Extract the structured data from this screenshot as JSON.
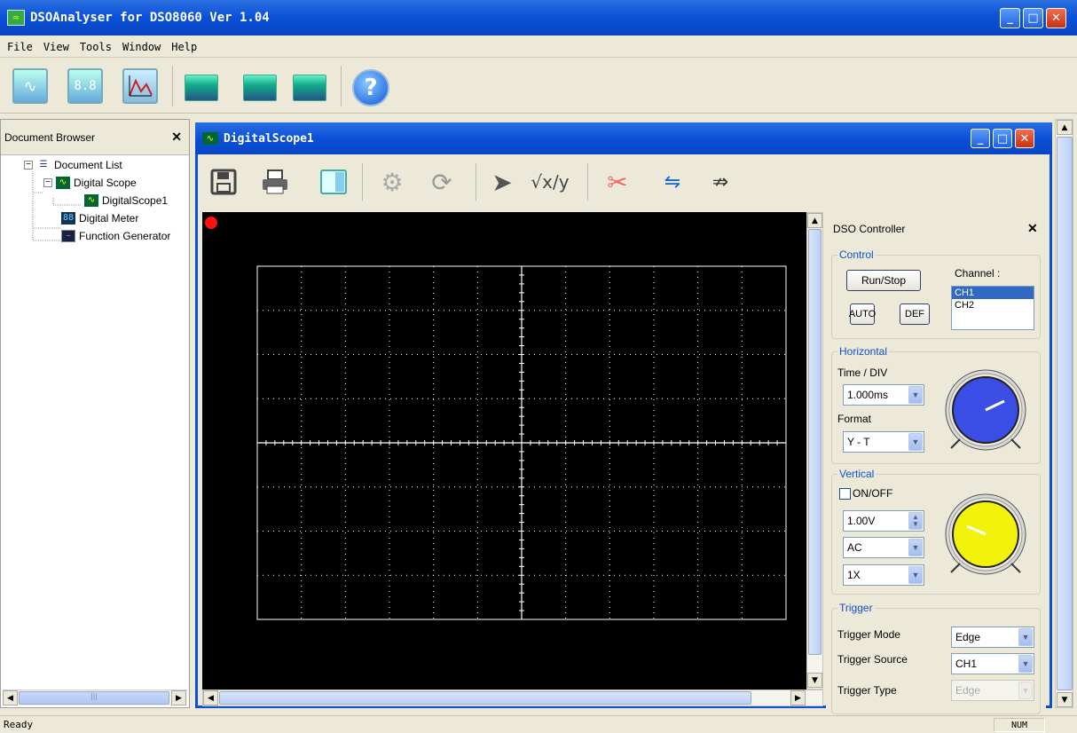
{
  "app": {
    "title": "DSOAnalyser for DSO8060 Ver 1.04"
  },
  "menu": [
    "File",
    "View",
    "Tools",
    "Window",
    "Help"
  ],
  "doc_browser": {
    "title": "Document Browser",
    "tree": {
      "root": "Document List",
      "scope": "Digital Scope",
      "scope_child": "DigitalScope1",
      "meter": "Digital Meter",
      "generator": "Function Generator"
    }
  },
  "child_window": {
    "title": "DigitalScope1"
  },
  "dso_controller": {
    "title": "DSO Controller",
    "control": {
      "group": "Control",
      "run_stop": "Run/Stop",
      "auto": "AUTO",
      "def": "DEF",
      "channel_label": "Channel :",
      "channels": [
        "CH1",
        "CH2"
      ],
      "selected_channel": "CH1"
    },
    "horizontal": {
      "group": "Horizontal",
      "time_div_label": "Time / DIV",
      "time_div": "1.000ms",
      "format_label": "Format",
      "format": "Y - T",
      "knob_color": "#3a4ee6"
    },
    "vertical": {
      "group": "Vertical",
      "on_off": "ON/OFF",
      "volts": "1.00V",
      "coupling": "AC",
      "probe": "1X",
      "knob_color": "#f2f20a"
    },
    "trigger": {
      "group": "Trigger",
      "mode_label": "Trigger Mode",
      "mode": "Edge",
      "source_label": "Trigger Source",
      "source": "CH1",
      "type_label": "Trigger Type",
      "type": "Edge"
    }
  },
  "status": {
    "text": "Ready",
    "num": "NUM"
  },
  "colors": {
    "titlebar": "#0a50d8",
    "scope_bg": "#000000",
    "grid": "#ffffff",
    "indicator": "#ff0000"
  }
}
